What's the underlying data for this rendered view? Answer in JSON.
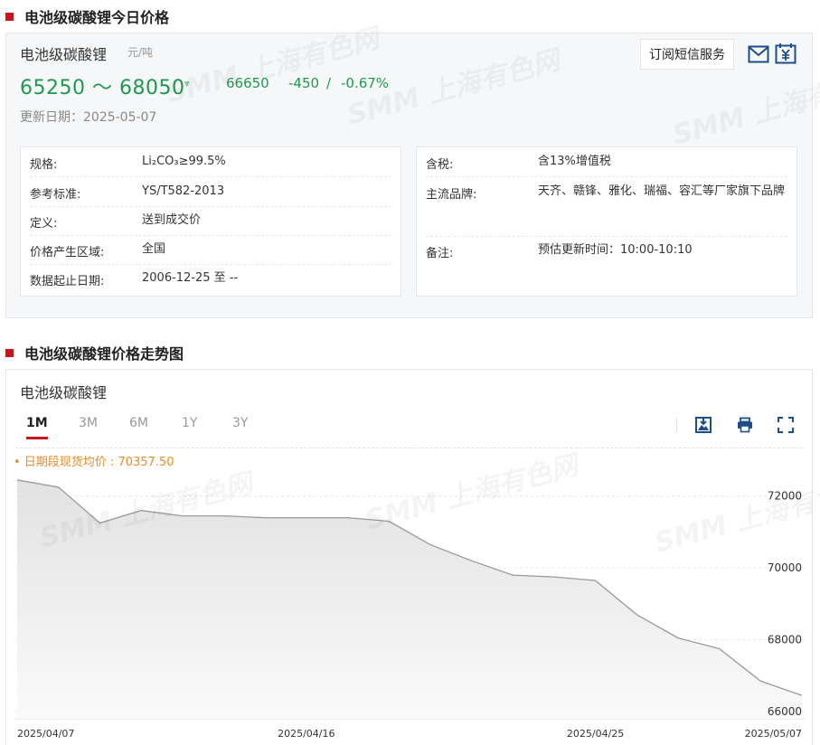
{
  "section1_title": "电池级碳酸锂今日价格",
  "section2_title": "电池级碳酸锂价格走势图",
  "watermark_text": "SMM 上海有色网",
  "price_panel": {
    "product_name": "电池级碳酸锂",
    "unit": "元/吨",
    "price_range": "65250 ～ 68050",
    "trend_glyph": "⩔",
    "avg_price": "66650",
    "change": "-450",
    "change_sep": "/",
    "change_pct": "-0.67%",
    "update_label": "更新日期：",
    "update_date": "2025-05-07",
    "subscribe_label": "订阅短信服务"
  },
  "spec_left": [
    {
      "k": "规格:",
      "v": "Li₂CO₃≥99.5%"
    },
    {
      "k": "参考标准:",
      "v": "YS/T582-2013"
    },
    {
      "k": "定义:",
      "v": "送到成交价"
    },
    {
      "k": "价格产生区域:",
      "v": "全国"
    },
    {
      "k": "数据起止日期:",
      "v": "2006-12-25 至 --"
    }
  ],
  "spec_right": [
    {
      "k": "含税:",
      "v": "含13%增值税"
    },
    {
      "k": "主流品牌:",
      "v": "天齐、赣锋、雅化、瑞福、容汇等厂家旗下品牌"
    },
    {
      "k": "备注:",
      "v": "预估更新时间：10:00-10:10"
    }
  ],
  "chart_card": {
    "title": "电池级碳酸锂",
    "tabs": [
      "1M",
      "3M",
      "6M",
      "1Y",
      "3Y"
    ],
    "active_tab": "1M",
    "legend": "• 日期段现货均价 : 70357.50"
  },
  "colors": {
    "accent_red": "#c9161c",
    "price_green": "#1d9a4c",
    "legend_orange": "#f08a24",
    "icon_blue": "#1a4f8b"
  },
  "chart_data": {
    "type": "area",
    "x": [
      "2025/04/07",
      "2025/04/08",
      "2025/04/09",
      "2025/04/10",
      "2025/04/11",
      "2025/04/14",
      "2025/04/15",
      "2025/04/16",
      "2025/04/17",
      "2025/04/18",
      "2025/04/21",
      "2025/04/22",
      "2025/04/23",
      "2025/04/24",
      "2025/04/25",
      "2025/04/28",
      "2025/04/29",
      "2025/04/30",
      "2025/05/06",
      "2025/05/07"
    ],
    "values": [
      72450,
      72250,
      71250,
      71600,
      71450,
      71450,
      71400,
      71400,
      71400,
      71300,
      70650,
      70200,
      69800,
      69750,
      69650,
      68700,
      68050,
      67750,
      66850,
      66450
    ],
    "x_tick_labels": [
      "2025/04/07",
      "2025/04/16",
      "2025/04/25",
      "2025/05/07"
    ],
    "x_tick_indices": [
      0,
      7,
      14,
      19
    ],
    "y_ticks": [
      66000,
      68000,
      70000,
      72000
    ],
    "ylim": [
      65800,
      73000
    ],
    "grid": "horizontal dashed",
    "legend": "top-left"
  }
}
